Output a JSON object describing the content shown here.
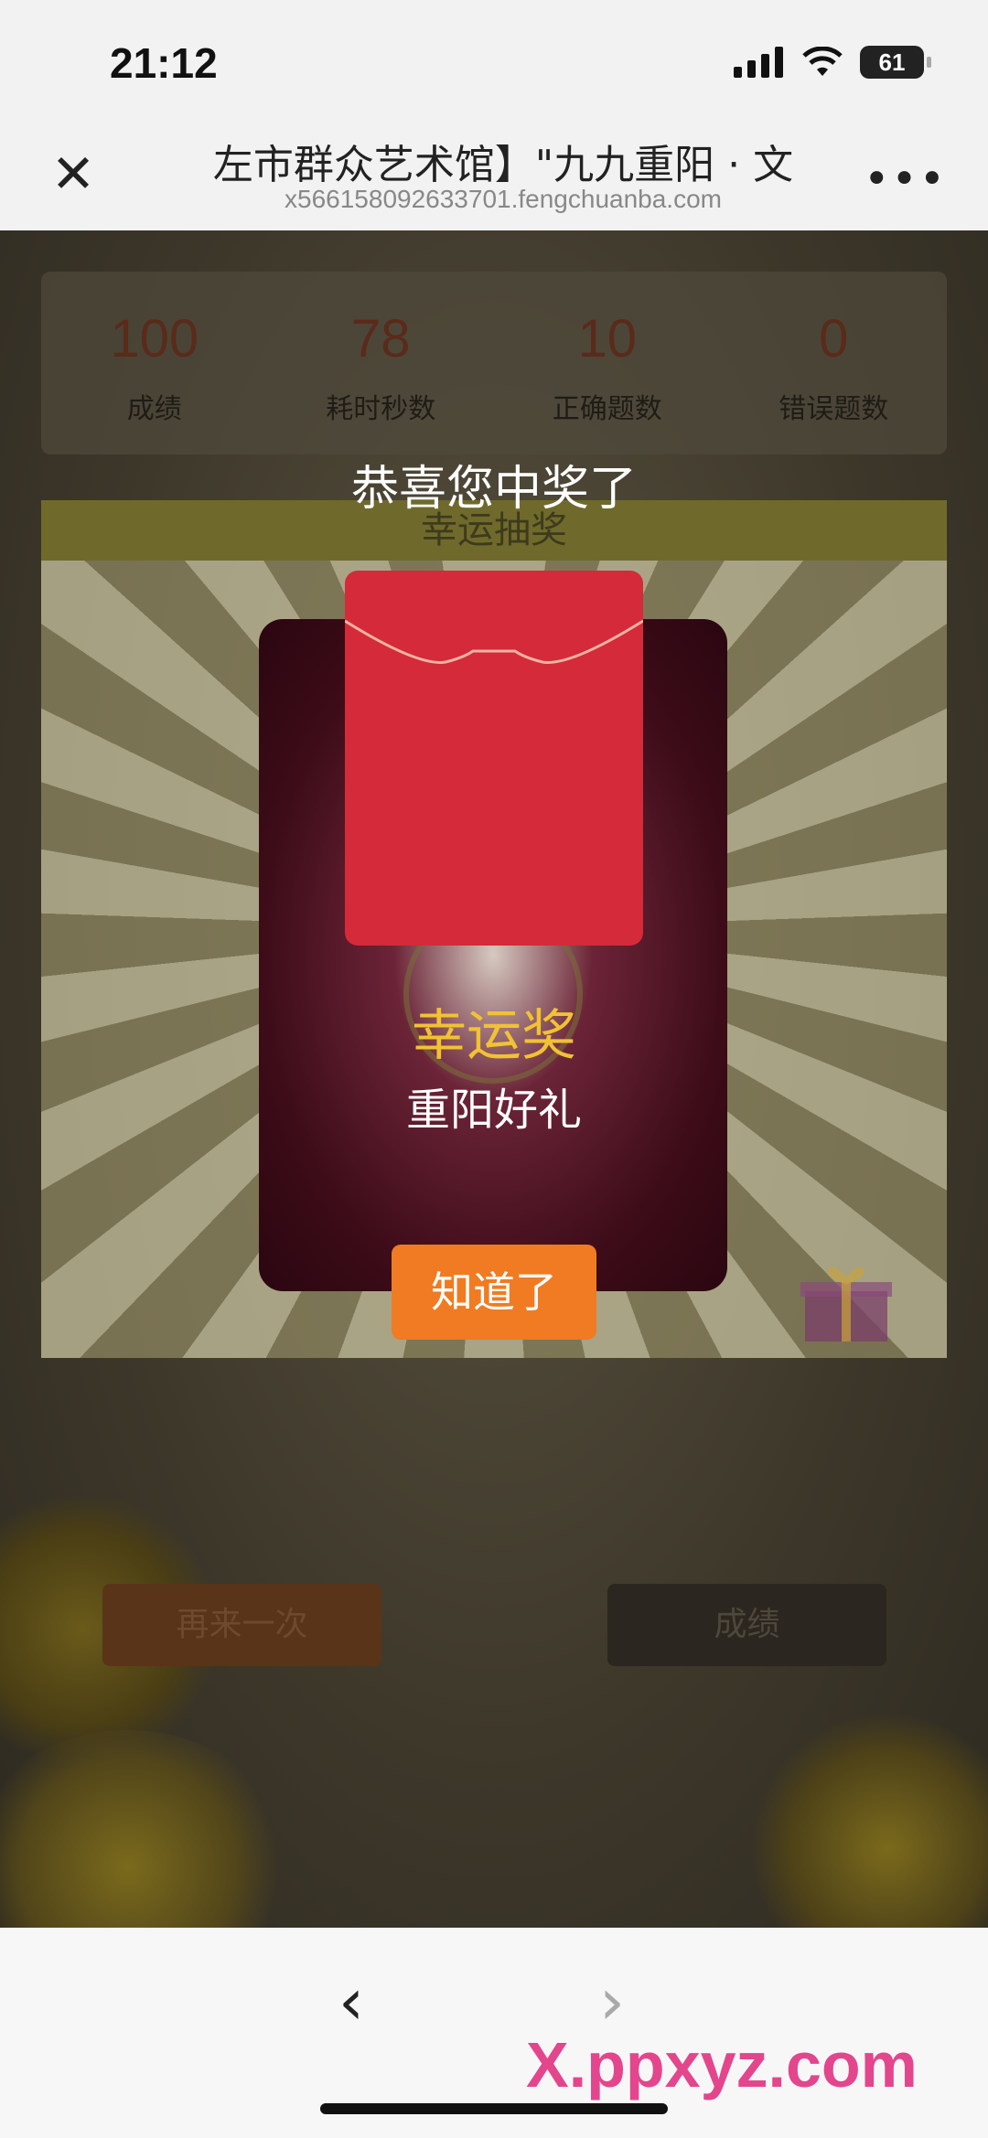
{
  "status": {
    "time": "21:12",
    "battery": "61"
  },
  "nav": {
    "title": "左市群众艺术馆】\"九九重阳 · 文",
    "url": "x566158092633701.fengchuanba.com"
  },
  "scores": [
    {
      "value": "100",
      "label": "成绩"
    },
    {
      "value": "78",
      "label": "耗时秒数"
    },
    {
      "value": "10",
      "label": "正确题数"
    },
    {
      "value": "0",
      "label": "错误题数"
    }
  ],
  "lottery": {
    "header": "幸运抽奖"
  },
  "modal": {
    "congrats": "恭喜您中奖了",
    "prize_name": "幸运奖",
    "prize_desc": "重阳好礼",
    "ok_label": "知道了"
  },
  "actions": {
    "retry_label": "再来一次",
    "score_label": "成绩"
  },
  "watermark": "X.ppxyz.com",
  "colors": {
    "accent": "#f07b22",
    "envelope": "#d42a3a",
    "prize_gold": "#f1c232"
  }
}
